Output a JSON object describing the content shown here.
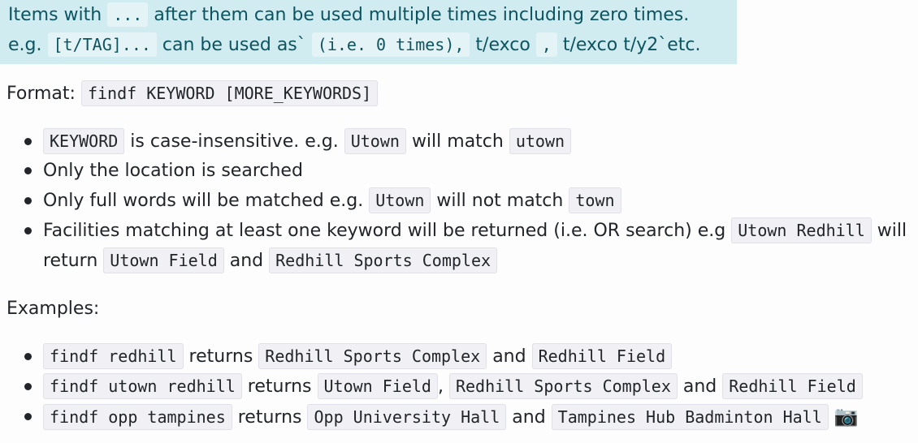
{
  "info": {
    "l1_code": "...",
    "l1_pre": "Items with",
    "l1_post": "after them can be used multiple times including zero times.",
    "l2_eg": "e.g.",
    "l2_code1": "[t/TAG]...",
    "l2_mid1": "can be used as`",
    "l2_code2": "(i.e. 0 times),",
    "l2_mid2": "t/exco",
    "l2_code3": ",",
    "l2_end": "t/exco t/y2`etc."
  },
  "format": {
    "label": "Format:",
    "code": "findf KEYWORD [MORE_KEYWORDS]"
  },
  "bullets": {
    "b1": {
      "c1": "KEYWORD",
      "t1": "is case-insensitive. e.g.",
      "c2": "Utown",
      "t2": "will match",
      "c3": "utown"
    },
    "b2": {
      "t1": "Only the location is searched"
    },
    "b3": {
      "t1": "Only full words will be matched e.g.",
      "c1": "Utown",
      "t2": "will not match",
      "c2": "town"
    },
    "b4": {
      "t1": "Facilities matching at least one keyword will be returned (i.e. OR search) e.g",
      "c1": "Utown Redhill",
      "t2": "will",
      "t3": "return",
      "c2": "Utown Field",
      "t4": "and",
      "c3": "Redhill Sports Complex"
    }
  },
  "examples": {
    "label": "Examples:",
    "e1": {
      "c1": "findf redhill",
      "t1": "returns",
      "c2": "Redhill Sports Complex",
      "t2": "and",
      "c3": "Redhill Field"
    },
    "e2": {
      "c1": "findf utown redhill",
      "t1": "returns",
      "c2": "Utown Field",
      "t2": ",",
      "c3": "Redhill Sports Complex",
      "t3": "and",
      "c4": "Redhill Field"
    },
    "e3": {
      "c1": "findf opp tampines",
      "t1": "returns",
      "c2": "Opp University Hall",
      "t2": "and",
      "c3": "Tampines Hub Badminton Hall",
      "icon": "camera-icon"
    }
  }
}
